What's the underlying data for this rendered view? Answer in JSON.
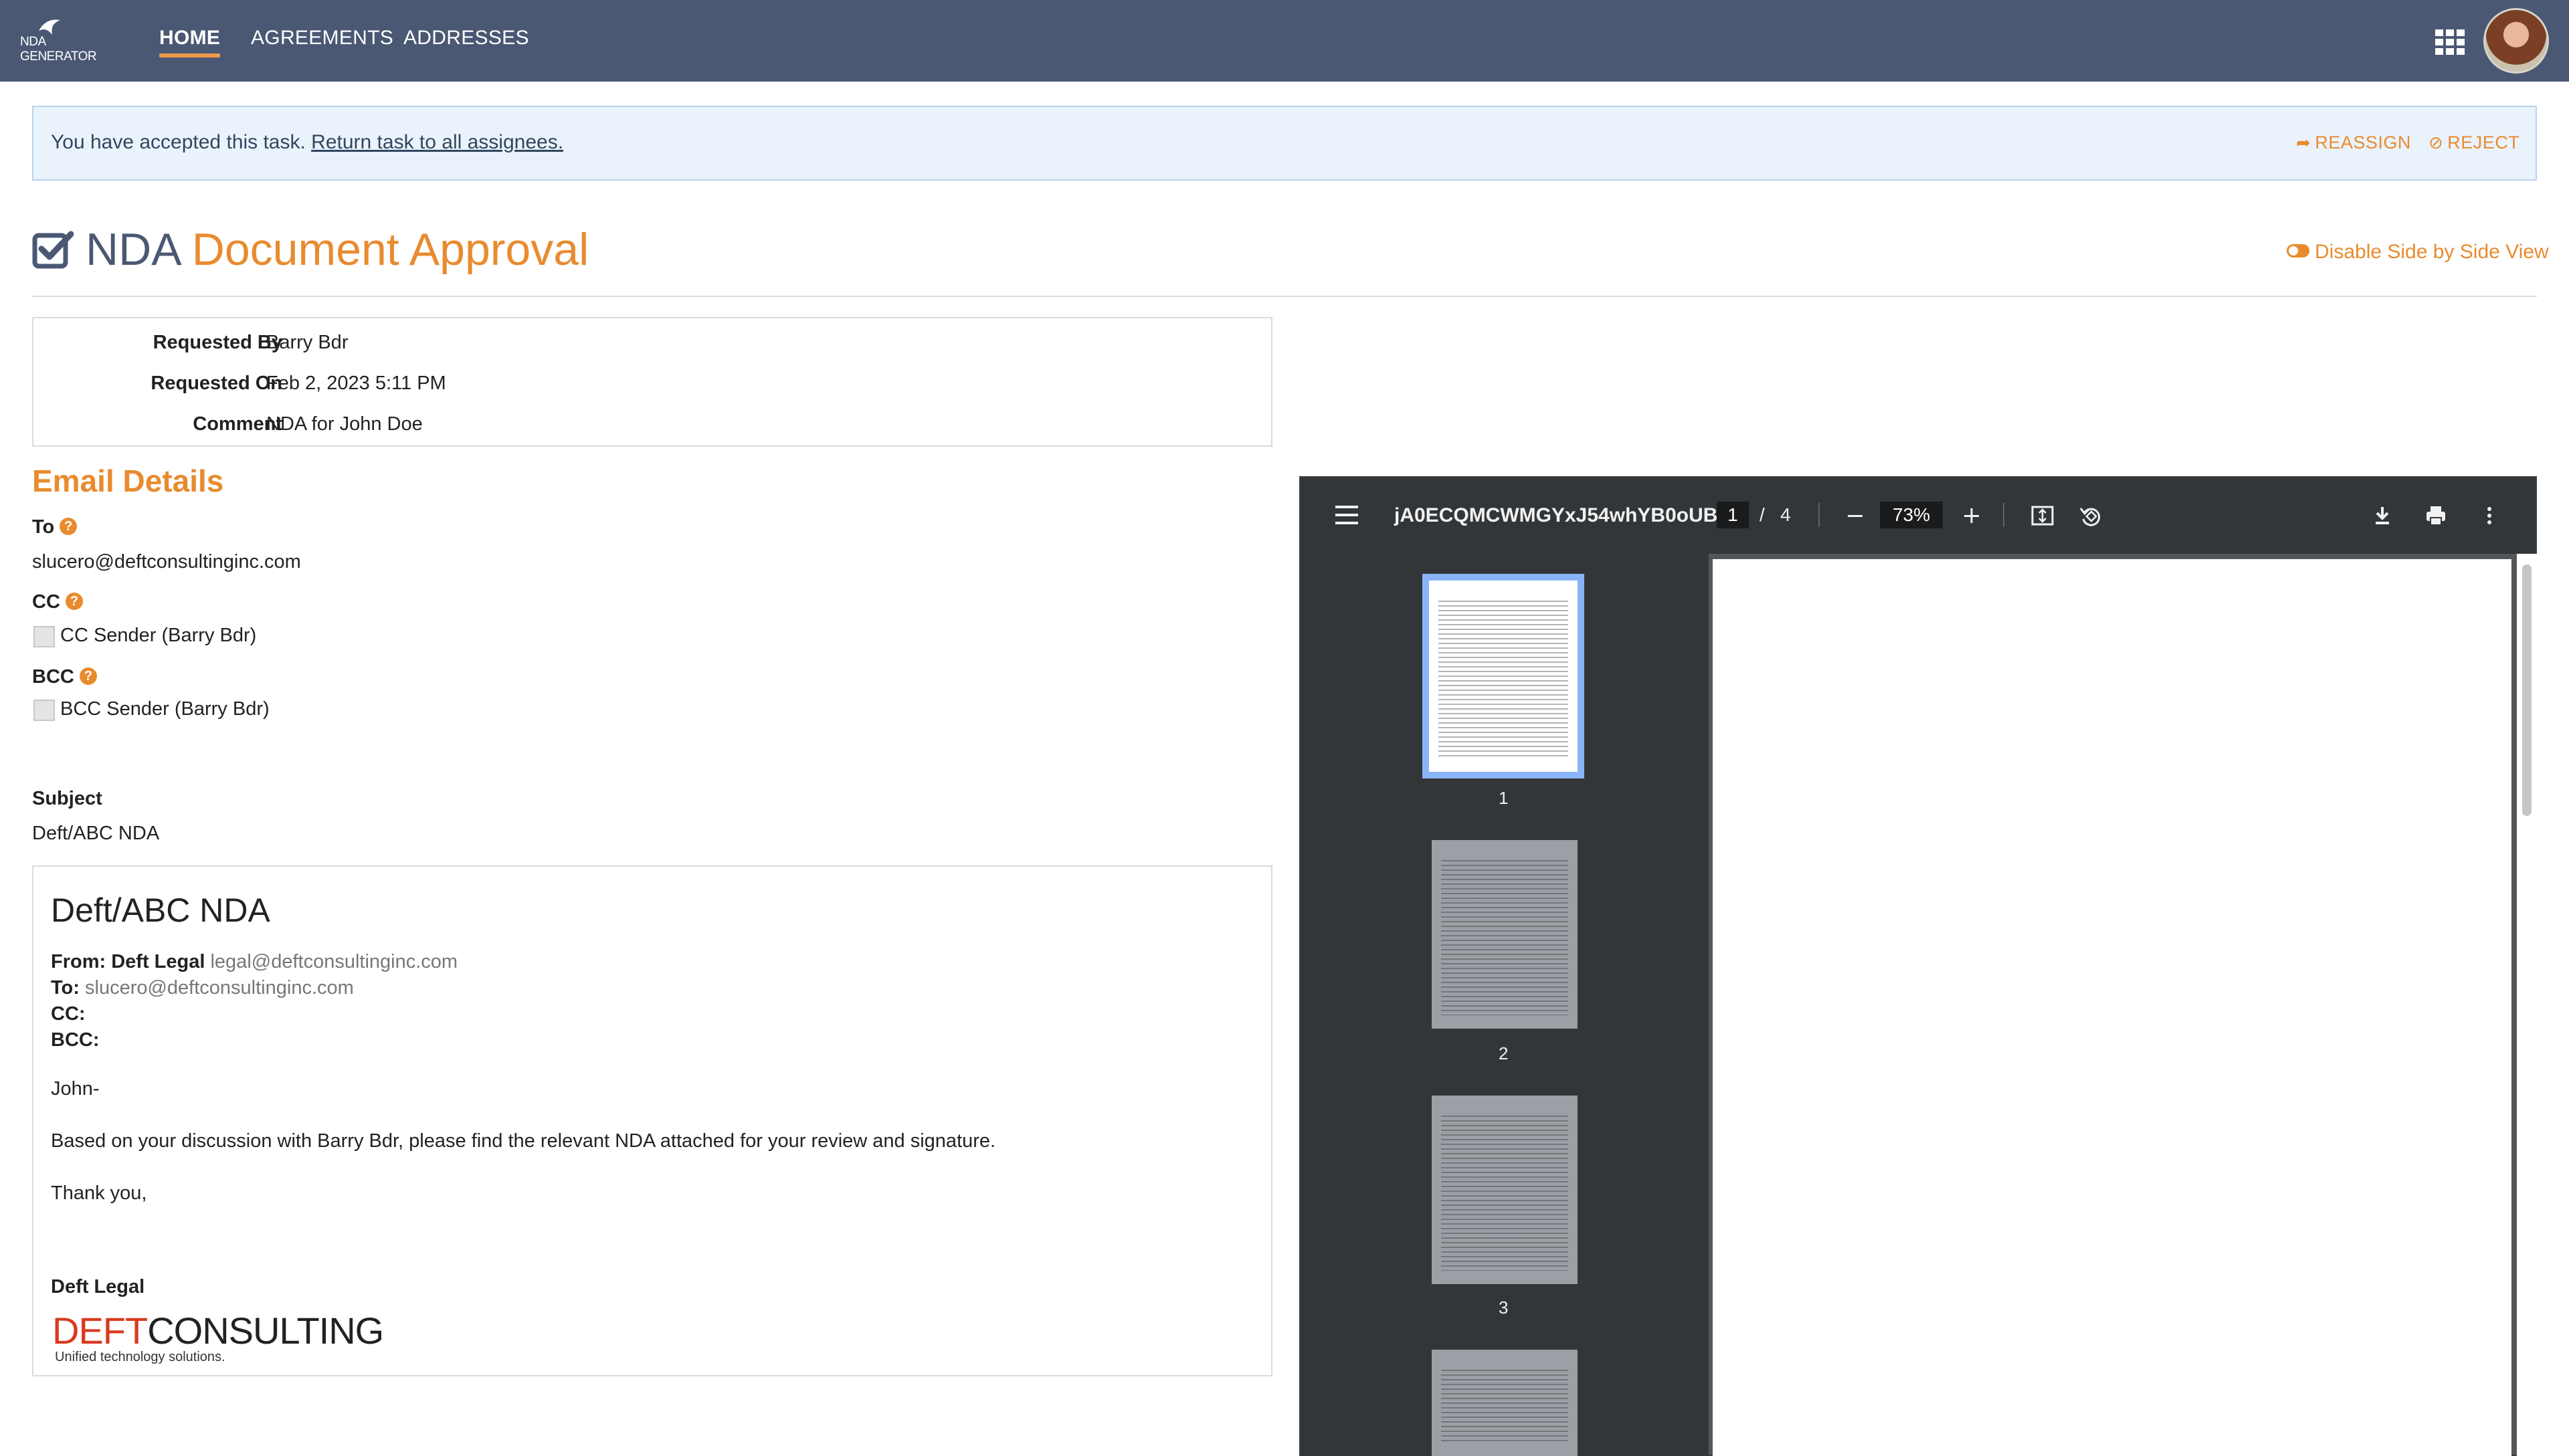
{
  "nav": {
    "logo_line1": "NDA",
    "logo_line2": "GENERATOR",
    "links": [
      "HOME",
      "AGREEMENTS",
      "ADDRESSES"
    ]
  },
  "alert": {
    "message": "You have accepted this task.",
    "link": "Return task to all assignees.",
    "reassign": "REASSIGN",
    "reject": "REJECT"
  },
  "header": {
    "title_part1": "NDA",
    "title_part2": "Document Approval",
    "toggle_label": "Disable Side by Side View"
  },
  "meta": [
    {
      "label": "Requested By",
      "value": "Barry Bdr"
    },
    {
      "label": "Requested On",
      "value": "Feb 2, 2023 5:11 PM"
    },
    {
      "label": "Comment",
      "value": "NDA for John Doe"
    }
  ],
  "email_details": {
    "heading": "Email Details",
    "to_label": "To",
    "to_value": "slucero@deftconsultinginc.com",
    "cc_label": "CC",
    "cc_checkbox": "CC Sender (Barry Bdr)",
    "bcc_label": "BCC",
    "bcc_checkbox": "BCC Sender (Barry Bdr)",
    "subject_label": "Subject",
    "subject_value": "Deft/ABC NDA"
  },
  "email_preview": {
    "title": "Deft/ABC NDA",
    "from_label": "From:",
    "from_name": "Deft Legal",
    "from_email": "legal@deftconsultinginc.com",
    "to_label": "To:",
    "to_email": "slucero@deftconsultinginc.com",
    "cc_label": "CC:",
    "bcc_label": "BCC:",
    "greeting": "John-",
    "body": "Based on your discussion with Barry Bdr, please find the relevant NDA attached for your review and signature.",
    "closing": "Thank you,",
    "signature": "Deft Legal",
    "logo_part1": "DEFT",
    "logo_part2": "CONSULTING",
    "logo_tagline": "Unified technology solutions."
  },
  "pdf_viewer": {
    "filename": "jA0ECQMCWMGYxJ54whYB0oUB...",
    "current_page": "1",
    "page_sep": "/",
    "total_pages": "4",
    "zoom": "73%",
    "thumbs": [
      "1",
      "2",
      "3"
    ]
  },
  "colors": {
    "nav_bg": "#4a5874",
    "accent": "#e88b2e",
    "alert_bg": "#eaf3fc",
    "pdf_toolbar": "#323639",
    "thumb_selected": "#8ab4f8"
  }
}
